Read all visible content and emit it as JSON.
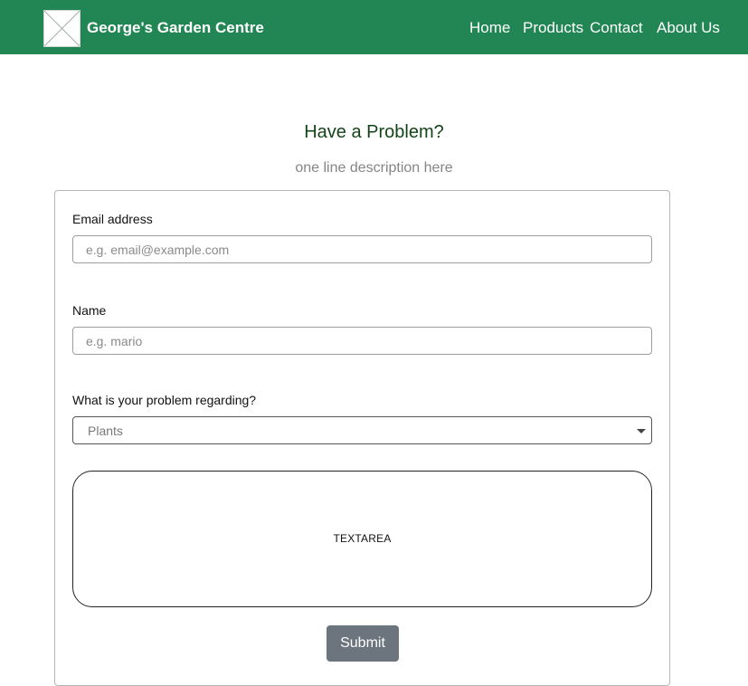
{
  "header": {
    "brand_name": "George's Garden Centre",
    "background_color": "#218654",
    "logo_icon": "image-placeholder-icon",
    "nav": [
      {
        "label": "Home"
      },
      {
        "label": "Products"
      },
      {
        "label": "Contact"
      },
      {
        "label": "About Us"
      }
    ]
  },
  "main": {
    "title": "Have a Problem?",
    "subtitle": "one line description here"
  },
  "form": {
    "email": {
      "label": "Email address",
      "placeholder": "e.g. email@example.com",
      "value": ""
    },
    "name": {
      "label": "Name",
      "placeholder": "e.g. mario",
      "value": ""
    },
    "topic": {
      "label": "What is your problem regarding?",
      "selected": "Plants",
      "icon": "caret-down-icon"
    },
    "message": {
      "label": "TEXTAREA"
    },
    "submit_label": "Submit"
  }
}
